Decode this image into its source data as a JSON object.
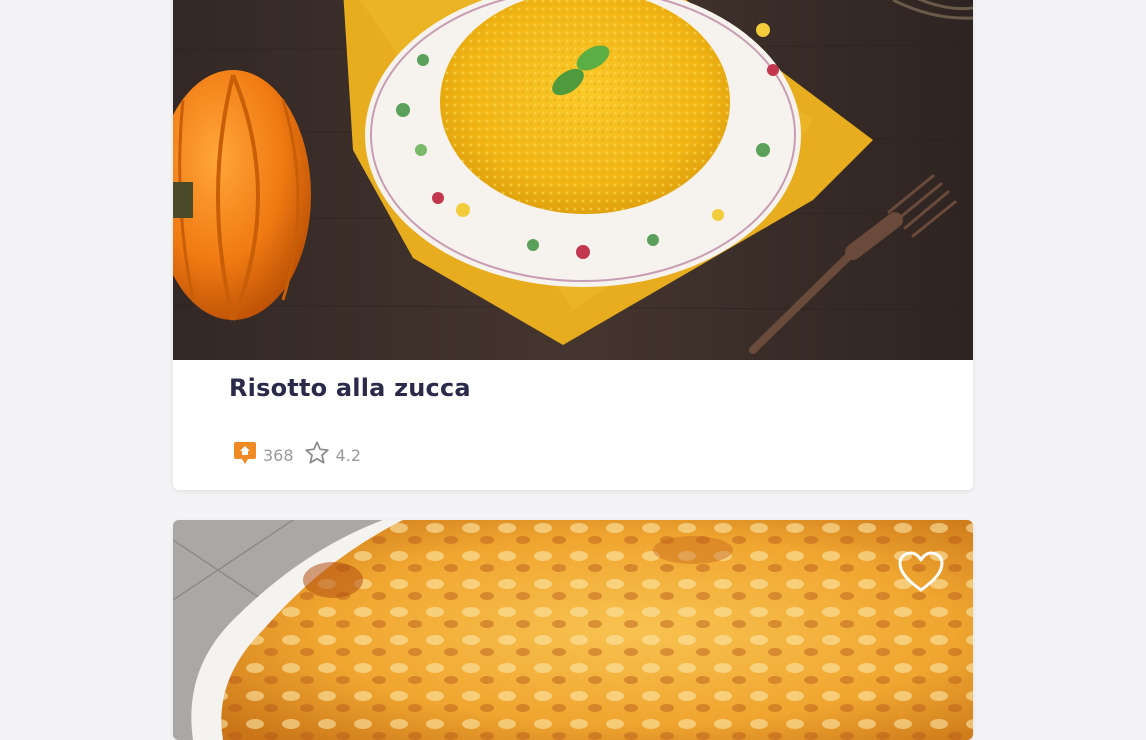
{
  "recipes": [
    {
      "title": "Risotto alla zucca",
      "stats": {
        "comments": "368",
        "rating": "4.2"
      }
    },
    {
      "favorite_icon": "heart-outline-icon"
    }
  ],
  "colors": {
    "background": "#f4f4f6",
    "title": "#2b2a4a",
    "badge": "#f08a24",
    "meta_text": "#9a9a9a"
  }
}
